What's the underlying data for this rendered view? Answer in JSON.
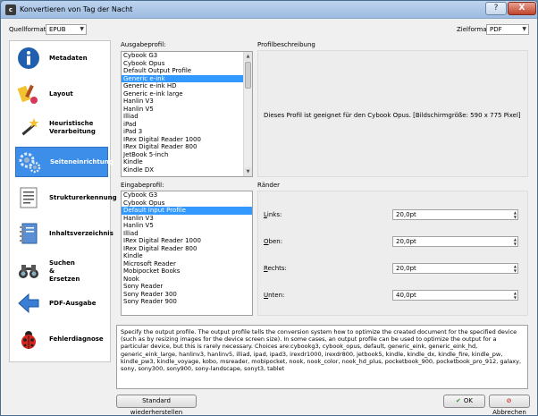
{
  "window": {
    "title": "Konvertieren von Tag der Nacht",
    "help_label": "?",
    "close_label": "X"
  },
  "format": {
    "source_label": "Quellformat:",
    "source_value": "EPUB",
    "target_label": "Zielformat:",
    "target_value": "PDF"
  },
  "sidebar": {
    "items": [
      {
        "label": "Metadaten",
        "icon": "info-icon"
      },
      {
        "label": "Layout",
        "icon": "paint-brush-icon"
      },
      {
        "label": "Heuristische\nVerarbeitung",
        "icon": "magic-wand-icon"
      },
      {
        "label": "Seiteneinrichtung",
        "icon": "gears-icon"
      },
      {
        "label": "Strukturerkennung",
        "icon": "document-lines-icon"
      },
      {
        "label": "Inhaltsverzeichnis",
        "icon": "notebook-icon"
      },
      {
        "label": "Suchen\n&\nErsetzen",
        "icon": "binoculars-icon"
      },
      {
        "label": "PDF-Ausgabe",
        "icon": "arrow-left-icon"
      },
      {
        "label": "Fehlerdiagnose",
        "icon": "ladybug-icon"
      }
    ],
    "selected_index": 3
  },
  "output_profile": {
    "label": "Ausgabeprofil:",
    "items": [
      "Cybook G3",
      "Cybook Opus",
      "Default Output Profile",
      "Generic e-ink",
      "Generic e-ink HD",
      "Generic e-ink large",
      "Hanlin V3",
      "Hanlin V5",
      "Illiad",
      "iPad",
      "iPad 3",
      "IRex Digital Reader 1000",
      "IRex Digital Reader 800",
      "JetBook 5-inch",
      "Kindle",
      "Kindle DX"
    ],
    "selected": "Generic e-ink"
  },
  "profile_description": {
    "label": "Profilbeschreibung",
    "text": "Dieses Profil ist geeignet für den Cybook Opus. [Bildschirmgröße: 590 x 775 Pixel]"
  },
  "input_profile": {
    "label": "Eingabeprofil:",
    "items": [
      "Cybook G3",
      "Cybook Opus",
      "Default Input Profile",
      "Hanlin V3",
      "Hanlin V5",
      "Illiad",
      "IRex Digital Reader 1000",
      "IRex Digital Reader 800",
      "Kindle",
      "Microsoft Reader",
      "Mobipocket Books",
      "Nook",
      "Sony Reader",
      "Sony Reader 300",
      "Sony Reader 900"
    ],
    "selected": "Default Input Profile"
  },
  "margins": {
    "label": "Ränder",
    "fields": [
      {
        "key": "L",
        "rest": "inks:",
        "value": "20,0pt"
      },
      {
        "key": "O",
        "rest": "ben:",
        "value": "20,0pt"
      },
      {
        "key": "R",
        "rest": "echts:",
        "value": "20,0pt"
      },
      {
        "key": "U",
        "rest": "nten:",
        "value": "40,0pt"
      }
    ]
  },
  "help_text": "Specify the output profile. The output profile tells the conversion system how to optimize the created document for the specified device (such as by resizing images for the device screen size). In some cases, an output profile can be used to optimize the output for a particular device, but this is rarely necessary. Choices are:cybookg3, cybook_opus, default, generic_eink, generic_eink_hd, generic_eink_large, hanlinv3, hanlinv5, illiad, ipad, ipad3, irexdr1000, irexdr800, jetbook5, kindle, kindle_dx, kindle_fire, kindle_pw, kindle_pw3, kindle_voyage, kobo, msreader, mobipocket, nook, nook_color, nook_hd_plus, pocketbook_900, pocketbook_pro_912, galaxy, sony, sony300, sony900, sony-landscape, sonyt3, tablet",
  "buttons": {
    "restore": "Standard wiederherstellen",
    "ok": "OK",
    "cancel": "Abbrechen"
  }
}
